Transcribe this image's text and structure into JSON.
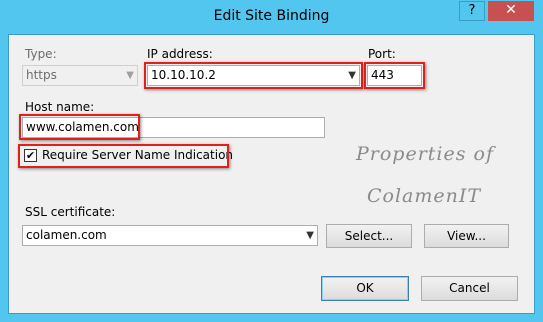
{
  "window": {
    "title": "Edit Site Binding",
    "help_label": "?",
    "close_label": "✕"
  },
  "form": {
    "type_label": "Type:",
    "type_value": "https",
    "ip_label": "IP address:",
    "ip_value": "10.10.10.2",
    "port_label": "Port:",
    "port_value": "443",
    "host_label": "Host name:",
    "host_value": "www.colamen.com",
    "sni_label": "Require Server Name Indication",
    "sni_checked": true,
    "ssl_label": "SSL certificate:",
    "ssl_value": "colamen.com"
  },
  "buttons": {
    "select": "Select...",
    "view": "View...",
    "ok": "OK",
    "cancel": "Cancel"
  },
  "watermark": {
    "line1": "Properties of",
    "line2": "ColamenIT"
  },
  "icons": {
    "dropdown": "chevron-down-icon",
    "check": "checkmark-icon"
  },
  "colors": {
    "title_bar": "#52c6ee",
    "close_button": "#c75050",
    "highlight": "#e0201b"
  }
}
